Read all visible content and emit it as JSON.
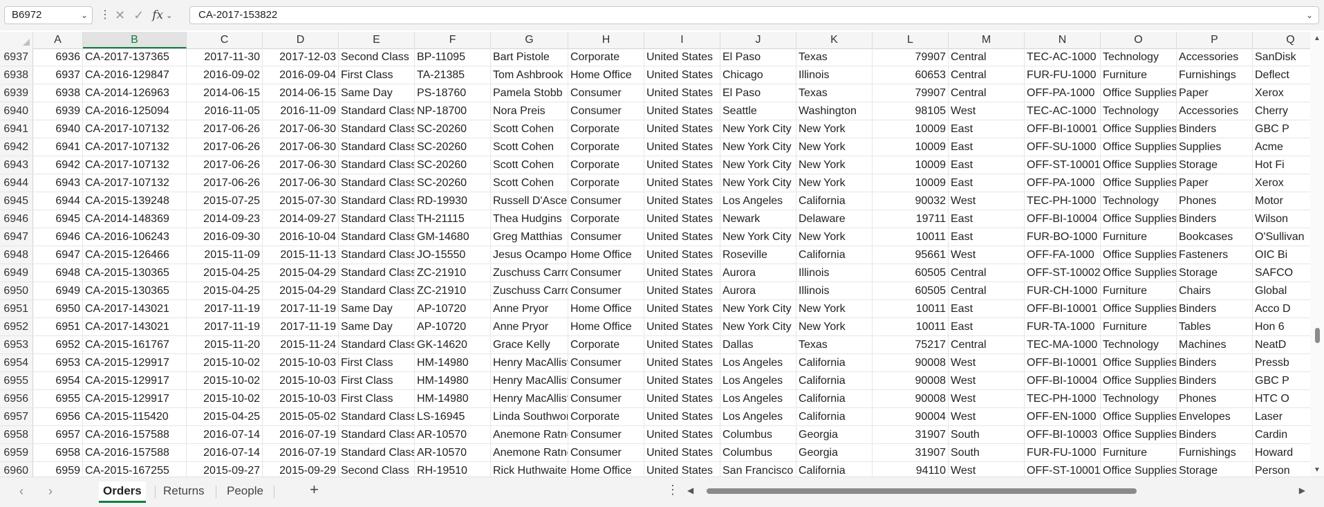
{
  "formula_bar": {
    "name_box": "B6972",
    "formula": "CA-2017-153822",
    "fx_label": "fx"
  },
  "columns": [
    "A",
    "B",
    "C",
    "D",
    "E",
    "F",
    "G",
    "H",
    "I",
    "J",
    "K",
    "L",
    "M",
    "N",
    "O",
    "P",
    "Q"
  ],
  "selected_column": "B",
  "rows": [
    {
      "n": "6937",
      "cells": [
        "6936",
        "CA-2017-137365",
        "2017-11-30",
        "2017-12-03",
        "Second Class",
        "BP-11095",
        "Bart Pistole",
        "Corporate",
        "United States",
        "El Paso",
        "Texas",
        "79907",
        "Central",
        "TEC-AC-1000",
        "Technology",
        "Accessories",
        "SanDisk"
      ]
    },
    {
      "n": "6938",
      "cells": [
        "6937",
        "CA-2016-129847",
        "2016-09-02",
        "2016-09-04",
        "First Class",
        "TA-21385",
        "Tom Ashbrook",
        "Home Office",
        "United States",
        "Chicago",
        "Illinois",
        "60653",
        "Central",
        "FUR-FU-1000",
        "Furniture",
        "Furnishings",
        "Deflect"
      ]
    },
    {
      "n": "6939",
      "cells": [
        "6938",
        "CA-2014-126963",
        "2014-06-15",
        "2014-06-15",
        "Same Day",
        "PS-18760",
        "Pamela Stobb",
        "Consumer",
        "United States",
        "El Paso",
        "Texas",
        "79907",
        "Central",
        "OFF-PA-1000",
        "Office Supplies",
        "Paper",
        "Xerox"
      ]
    },
    {
      "n": "6940",
      "cells": [
        "6939",
        "CA-2016-125094",
        "2016-11-05",
        "2016-11-09",
        "Standard Class",
        "NP-18700",
        "Nora Preis",
        "Consumer",
        "United States",
        "Seattle",
        "Washington",
        "98105",
        "West",
        "TEC-AC-1000",
        "Technology",
        "Accessories",
        "Cherry"
      ]
    },
    {
      "n": "6941",
      "cells": [
        "6940",
        "CA-2017-107132",
        "2017-06-26",
        "2017-06-30",
        "Standard Class",
        "SC-20260",
        "Scott Cohen",
        "Corporate",
        "United States",
        "New York City",
        "New York",
        "10009",
        "East",
        "OFF-BI-10001",
        "Office Supplies",
        "Binders",
        "GBC P"
      ]
    },
    {
      "n": "6942",
      "cells": [
        "6941",
        "CA-2017-107132",
        "2017-06-26",
        "2017-06-30",
        "Standard Class",
        "SC-20260",
        "Scott Cohen",
        "Corporate",
        "United States",
        "New York City",
        "New York",
        "10009",
        "East",
        "OFF-SU-1000",
        "Office Supplies",
        "Supplies",
        "Acme"
      ]
    },
    {
      "n": "6943",
      "cells": [
        "6942",
        "CA-2017-107132",
        "2017-06-26",
        "2017-06-30",
        "Standard Class",
        "SC-20260",
        "Scott Cohen",
        "Corporate",
        "United States",
        "New York City",
        "New York",
        "10009",
        "East",
        "OFF-ST-10001",
        "Office Supplies",
        "Storage",
        "Hot Fi"
      ]
    },
    {
      "n": "6944",
      "cells": [
        "6943",
        "CA-2017-107132",
        "2017-06-26",
        "2017-06-30",
        "Standard Class",
        "SC-20260",
        "Scott Cohen",
        "Corporate",
        "United States",
        "New York City",
        "New York",
        "10009",
        "East",
        "OFF-PA-1000",
        "Office Supplies",
        "Paper",
        "Xerox"
      ]
    },
    {
      "n": "6945",
      "cells": [
        "6944",
        "CA-2015-139248",
        "2015-07-25",
        "2015-07-30",
        "Standard Class",
        "RD-19930",
        "Russell D'Ascenzo",
        "Consumer",
        "United States",
        "Los Angeles",
        "California",
        "90032",
        "West",
        "TEC-PH-1000",
        "Technology",
        "Phones",
        "Motor"
      ]
    },
    {
      "n": "6946",
      "cells": [
        "6945",
        "CA-2014-148369",
        "2014-09-23",
        "2014-09-27",
        "Standard Class",
        "TH-21115",
        "Thea Hudgins",
        "Corporate",
        "United States",
        "Newark",
        "Delaware",
        "19711",
        "East",
        "OFF-BI-10004",
        "Office Supplies",
        "Binders",
        "Wilson"
      ]
    },
    {
      "n": "6947",
      "cells": [
        "6946",
        "CA-2016-106243",
        "2016-09-30",
        "2016-10-04",
        "Standard Class",
        "GM-14680",
        "Greg Matthias",
        "Consumer",
        "United States",
        "New York City",
        "New York",
        "10011",
        "East",
        "FUR-BO-1000",
        "Furniture",
        "Bookcases",
        "O'Sullivan"
      ]
    },
    {
      "n": "6948",
      "cells": [
        "6947",
        "CA-2015-126466",
        "2015-11-09",
        "2015-11-13",
        "Standard Class",
        "JO-15550",
        "Jesus Ocampo",
        "Home Office",
        "United States",
        "Roseville",
        "California",
        "95661",
        "West",
        "OFF-FA-1000",
        "Office Supplies",
        "Fasteners",
        "OIC Bi"
      ]
    },
    {
      "n": "6949",
      "cells": [
        "6948",
        "CA-2015-130365",
        "2015-04-25",
        "2015-04-29",
        "Standard Class",
        "ZC-21910",
        "Zuschuss Carroll",
        "Consumer",
        "United States",
        "Aurora",
        "Illinois",
        "60505",
        "Central",
        "OFF-ST-10002",
        "Office Supplies",
        "Storage",
        "SAFCO"
      ]
    },
    {
      "n": "6950",
      "cells": [
        "6949",
        "CA-2015-130365",
        "2015-04-25",
        "2015-04-29",
        "Standard Class",
        "ZC-21910",
        "Zuschuss Carroll",
        "Consumer",
        "United States",
        "Aurora",
        "Illinois",
        "60505",
        "Central",
        "FUR-CH-1000",
        "Furniture",
        "Chairs",
        "Global"
      ]
    },
    {
      "n": "6951",
      "cells": [
        "6950",
        "CA-2017-143021",
        "2017-11-19",
        "2017-11-19",
        "Same Day",
        "AP-10720",
        "Anne Pryor",
        "Home Office",
        "United States",
        "New York City",
        "New York",
        "10011",
        "East",
        "OFF-BI-10001",
        "Office Supplies",
        "Binders",
        "Acco D"
      ]
    },
    {
      "n": "6952",
      "cells": [
        "6951",
        "CA-2017-143021",
        "2017-11-19",
        "2017-11-19",
        "Same Day",
        "AP-10720",
        "Anne Pryor",
        "Home Office",
        "United States",
        "New York City",
        "New York",
        "10011",
        "East",
        "FUR-TA-1000",
        "Furniture",
        "Tables",
        "Hon 6"
      ]
    },
    {
      "n": "6953",
      "cells": [
        "6952",
        "CA-2015-161767",
        "2015-11-20",
        "2015-11-24",
        "Standard Class",
        "GK-14620",
        "Grace Kelly",
        "Corporate",
        "United States",
        "Dallas",
        "Texas",
        "75217",
        "Central",
        "TEC-MA-1000",
        "Technology",
        "Machines",
        "NeatD"
      ]
    },
    {
      "n": "6954",
      "cells": [
        "6953",
        "CA-2015-129917",
        "2015-10-02",
        "2015-10-03",
        "First Class",
        "HM-14980",
        "Henry MacAllister",
        "Consumer",
        "United States",
        "Los Angeles",
        "California",
        "90008",
        "West",
        "OFF-BI-10001",
        "Office Supplies",
        "Binders",
        "Pressb"
      ]
    },
    {
      "n": "6955",
      "cells": [
        "6954",
        "CA-2015-129917",
        "2015-10-02",
        "2015-10-03",
        "First Class",
        "HM-14980",
        "Henry MacAllister",
        "Consumer",
        "United States",
        "Los Angeles",
        "California",
        "90008",
        "West",
        "OFF-BI-10004",
        "Office Supplies",
        "Binders",
        "GBC P"
      ]
    },
    {
      "n": "6956",
      "cells": [
        "6955",
        "CA-2015-129917",
        "2015-10-02",
        "2015-10-03",
        "First Class",
        "HM-14980",
        "Henry MacAllister",
        "Consumer",
        "United States",
        "Los Angeles",
        "California",
        "90008",
        "West",
        "TEC-PH-1000",
        "Technology",
        "Phones",
        "HTC O"
      ]
    },
    {
      "n": "6957",
      "cells": [
        "6956",
        "CA-2015-115420",
        "2015-04-25",
        "2015-05-02",
        "Standard Class",
        "LS-16945",
        "Linda Southworth",
        "Corporate",
        "United States",
        "Los Angeles",
        "California",
        "90004",
        "West",
        "OFF-EN-1000",
        "Office Supplies",
        "Envelopes",
        "Laser"
      ]
    },
    {
      "n": "6958",
      "cells": [
        "6957",
        "CA-2016-157588",
        "2016-07-14",
        "2016-07-19",
        "Standard Class",
        "AR-10570",
        "Anemone Ratner",
        "Consumer",
        "United States",
        "Columbus",
        "Georgia",
        "31907",
        "South",
        "OFF-BI-10003",
        "Office Supplies",
        "Binders",
        "Cardin"
      ]
    },
    {
      "n": "6959",
      "cells": [
        "6958",
        "CA-2016-157588",
        "2016-07-14",
        "2016-07-19",
        "Standard Class",
        "AR-10570",
        "Anemone Ratner",
        "Consumer",
        "United States",
        "Columbus",
        "Georgia",
        "31907",
        "South",
        "FUR-FU-1000",
        "Furniture",
        "Furnishings",
        "Howard"
      ]
    },
    {
      "n": "6960",
      "cells": [
        "6959",
        "CA-2015-167255",
        "2015-09-27",
        "2015-09-29",
        "Second Class",
        "RH-19510",
        "Rick Huthwaite",
        "Home Office",
        "United States",
        "San Francisco",
        "California",
        "94110",
        "West",
        "OFF-ST-10001",
        "Office Supplies",
        "Storage",
        "Person"
      ]
    }
  ],
  "sheet_tabs": [
    "Orders",
    "Returns",
    "People"
  ],
  "active_tab": "Orders",
  "icons": {
    "name_dropdown": "chevron-down-icon",
    "more": "vertical-dots-icon",
    "cancel": "x-icon",
    "confirm": "check-icon",
    "insert_function": "fx-icon",
    "add_sheet": "plus-icon"
  },
  "colors": {
    "accent": "#107c41",
    "header_bg": "#f5f5f5",
    "grid_line": "#e6e6e6"
  }
}
